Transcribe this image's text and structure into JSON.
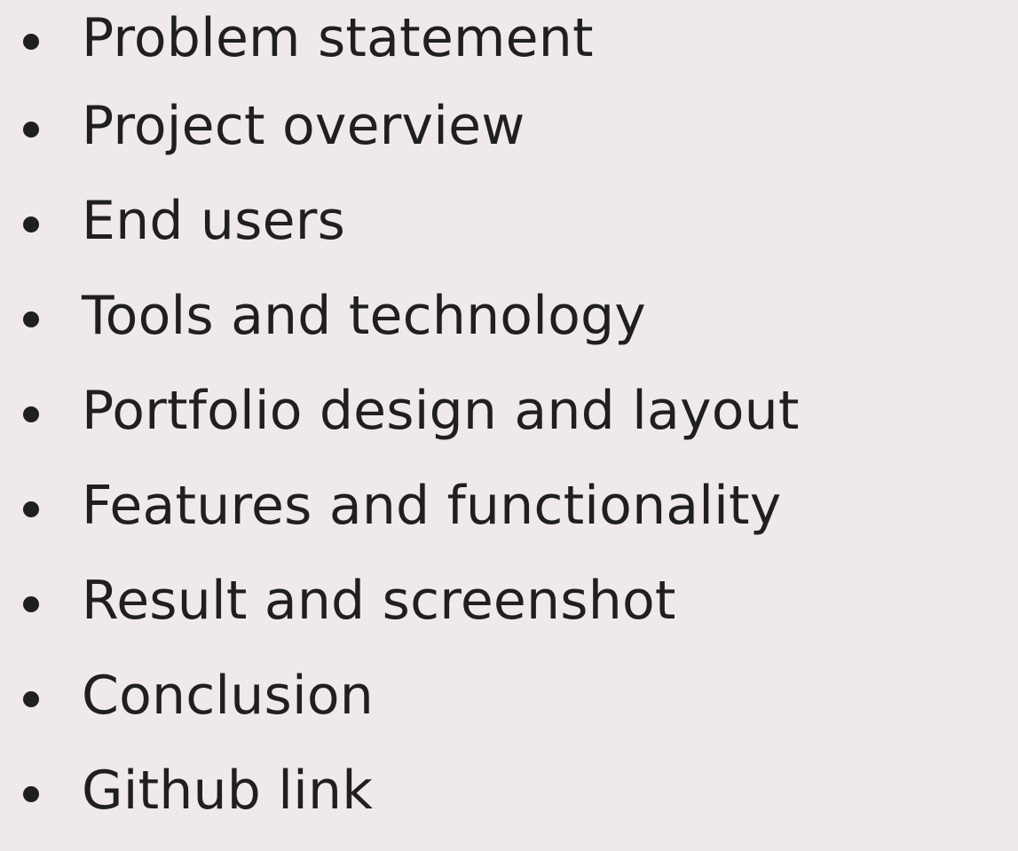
{
  "agenda": {
    "items": [
      "Problem statement",
      "Project overview",
      "End users",
      "Tools and technology",
      "Portfolio design and layout",
      "Features and functionality",
      "Result and screenshot",
      "Conclusion",
      "Github link"
    ]
  }
}
